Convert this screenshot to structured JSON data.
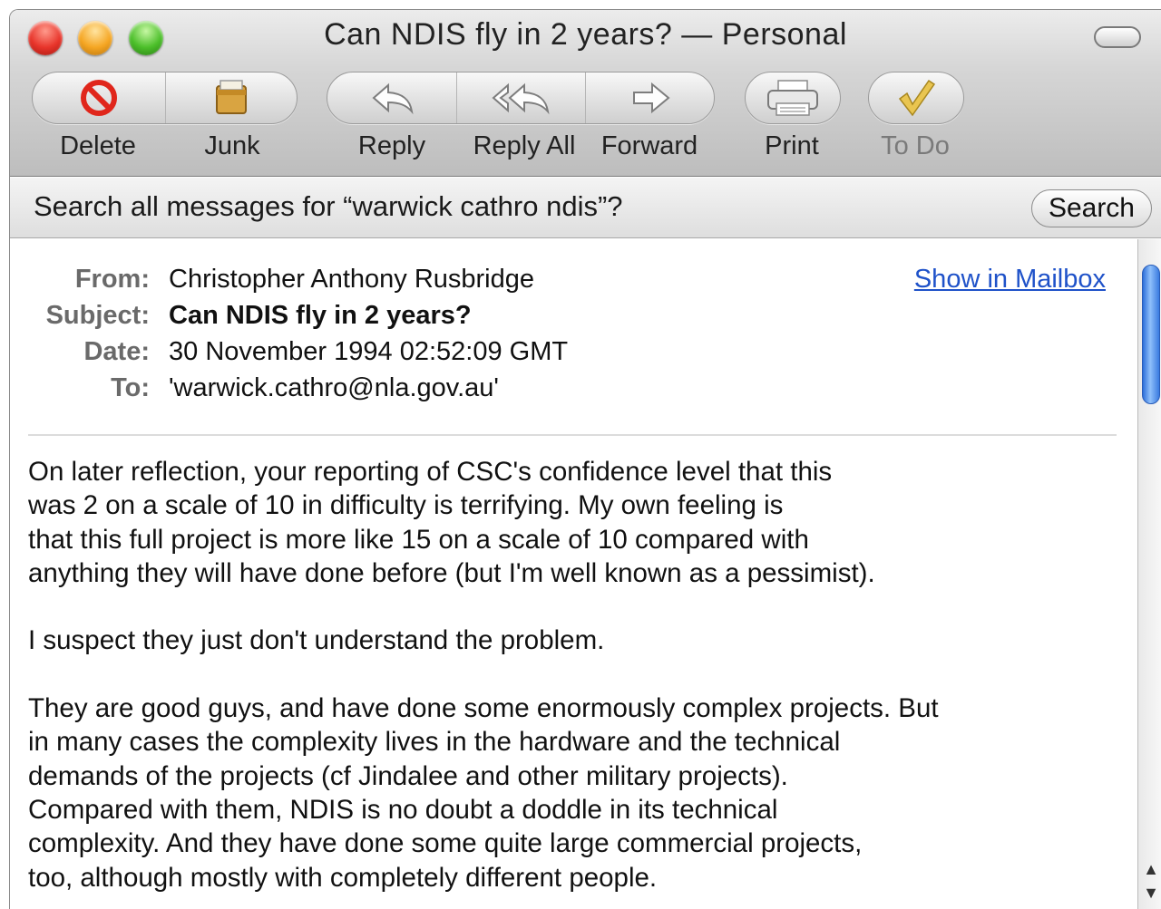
{
  "window": {
    "title": "Can NDIS fly in 2 years? — Personal"
  },
  "toolbar": {
    "delete_label": "Delete",
    "junk_label": "Junk",
    "reply_label": "Reply",
    "reply_all_label": "Reply All",
    "forward_label": "Forward",
    "print_label": "Print",
    "todo_label": "To Do"
  },
  "search": {
    "prompt": "Search all messages for “warwick cathro ndis”?",
    "button_label": "Search"
  },
  "message": {
    "from_label": "From:",
    "from": "Christopher Anthony Rusbridge",
    "subject_label": "Subject:",
    "subject": "Can NDIS fly in 2 years?",
    "date_label": "Date:",
    "date": "30 November 1994 02:52:09 GMT",
    "to_label": "To:",
    "to": "'warwick.cathro@nla.gov.au'",
    "show_in_mailbox": "Show in Mailbox",
    "paragraphs": [
      "On later reflection, your reporting of CSC's confidence level that this\nwas 2 on a scale of 10 in difficulty is terrifying. My own feeling is\nthat this full project is more like 15 on a scale of 10 compared with\nanything they will have done before (but I'm well known as a pessimist).",
      "I suspect they just don't understand the problem.",
      "They are good guys, and have done some enormously complex projects. But\nin many cases the complexity lives in the hardware and the technical\ndemands of the projects (cf Jindalee and other military projects).\nCompared with them, NDIS is no doubt a doddle in its technical\ncomplexity. And they have done some quite large commercial projects,\ntoo, although mostly with completely different people."
    ]
  },
  "icons": {
    "delete": "no-entry-icon",
    "junk": "junk-bag-icon",
    "reply": "reply-arrow-icon",
    "reply_all": "reply-all-arrow-icon",
    "forward": "forward-arrow-icon",
    "print": "printer-icon",
    "todo": "checkmark-icon"
  },
  "colors": {
    "link": "#1f52c9",
    "close": "#e8352b",
    "minimize": "#f5a623",
    "zoom": "#4cbf2a",
    "scroll_thumb": "#3a7be0"
  }
}
